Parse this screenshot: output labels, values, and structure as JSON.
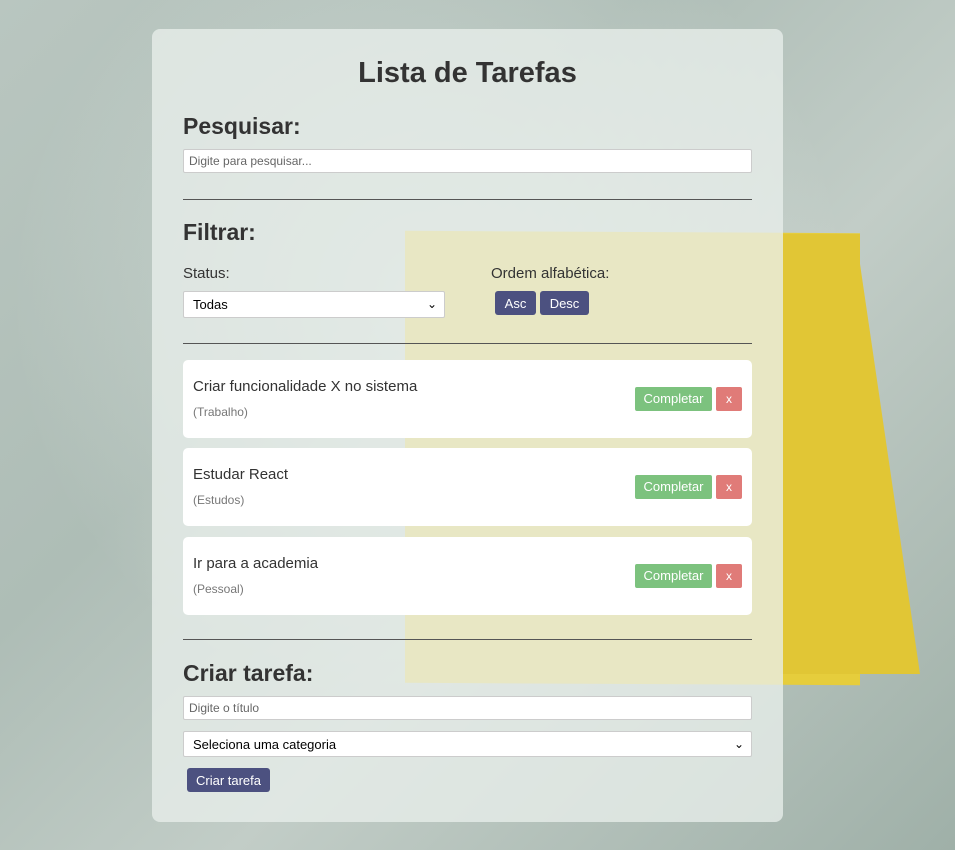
{
  "app": {
    "title": "Lista de Tarefas"
  },
  "search": {
    "heading": "Pesquisar:",
    "placeholder": "Digite para pesquisar..."
  },
  "filter": {
    "heading": "Filtrar:",
    "status_label": "Status:",
    "status_selected": "Todas",
    "order_label": "Ordem alfabética:",
    "asc_label": "Asc",
    "desc_label": "Desc"
  },
  "tasks": [
    {
      "title": "Criar funcionalidade X no sistema",
      "category": "(Trabalho)",
      "complete_label": "Completar",
      "delete_label": "x"
    },
    {
      "title": "Estudar React",
      "category": "(Estudos)",
      "complete_label": "Completar",
      "delete_label": "x"
    },
    {
      "title": "Ir para a academia",
      "category": "(Pessoal)",
      "complete_label": "Completar",
      "delete_label": "x"
    }
  ],
  "create": {
    "heading": "Criar tarefa:",
    "title_placeholder": "Digite o título",
    "category_selected": "Seleciona uma categoria",
    "submit_label": "Criar tarefa"
  },
  "colors": {
    "primary_button": "#4c5180",
    "complete_button": "#7cc27e",
    "delete_button": "#e07b78",
    "sticky_note": "#e6cd3c"
  }
}
